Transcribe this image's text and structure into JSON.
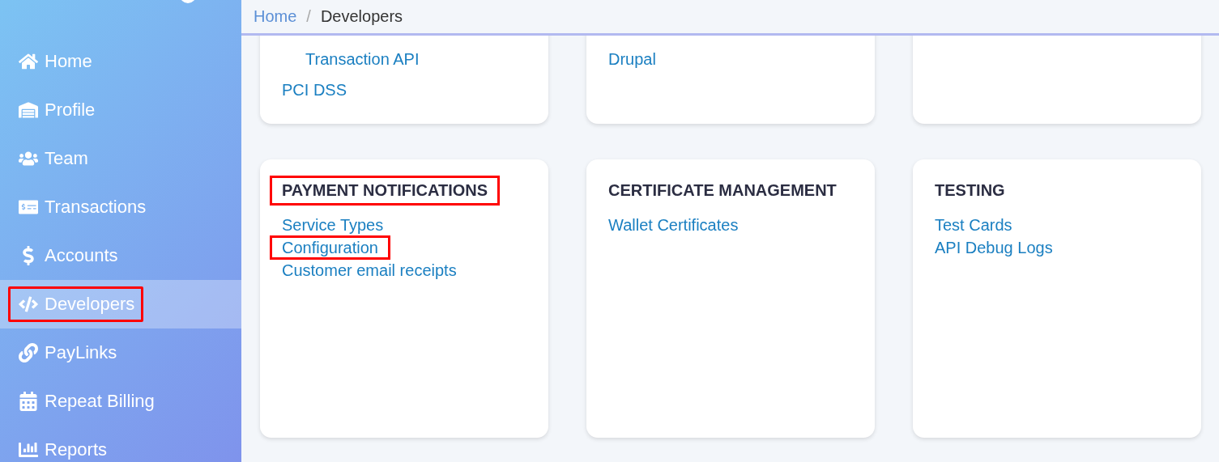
{
  "sidebar": {
    "items": [
      {
        "label": "Home",
        "selected": false,
        "highlighted": false
      },
      {
        "label": "Profile",
        "selected": false,
        "highlighted": false
      },
      {
        "label": "Team",
        "selected": false,
        "highlighted": false
      },
      {
        "label": "Transactions",
        "selected": false,
        "highlighted": false
      },
      {
        "label": "Accounts",
        "selected": false,
        "highlighted": false
      },
      {
        "label": "Developers",
        "selected": true,
        "highlighted": true
      },
      {
        "label": "PayLinks",
        "selected": false,
        "highlighted": false
      },
      {
        "label": "Repeat Billing",
        "selected": false,
        "highlighted": false
      },
      {
        "label": "Reports",
        "selected": false,
        "highlighted": false
      }
    ]
  },
  "breadcrumb": {
    "separator": "/",
    "items": [
      {
        "label": "Home",
        "current": false
      },
      {
        "label": "Developers",
        "current": true
      }
    ]
  },
  "upper_cards": [
    {
      "links": [
        {
          "children": [
            {
              "label": "Transaction API"
            }
          ]
        },
        {
          "label": "PCI DSS"
        }
      ]
    },
    {
      "links": [
        {
          "label": "Drupal"
        }
      ]
    }
  ],
  "cards": [
    {
      "title": "PAYMENT NOTIFICATIONS",
      "highlighted": true,
      "links": [
        {
          "label": "Service Types",
          "highlighted": false
        },
        {
          "label": "Configuration",
          "highlighted": true
        },
        {
          "label": "Customer email receipts",
          "highlighted": false
        }
      ]
    },
    {
      "title": "CERTIFICATE MANAGEMENT",
      "highlighted": false,
      "links": [
        {
          "label": "Wallet Certificates",
          "highlighted": false
        }
      ]
    },
    {
      "title": "TESTING",
      "highlighted": false,
      "links": [
        {
          "label": "Test Cards",
          "highlighted": false
        },
        {
          "label": "API Debug Logs",
          "highlighted": false
        }
      ]
    }
  ]
}
